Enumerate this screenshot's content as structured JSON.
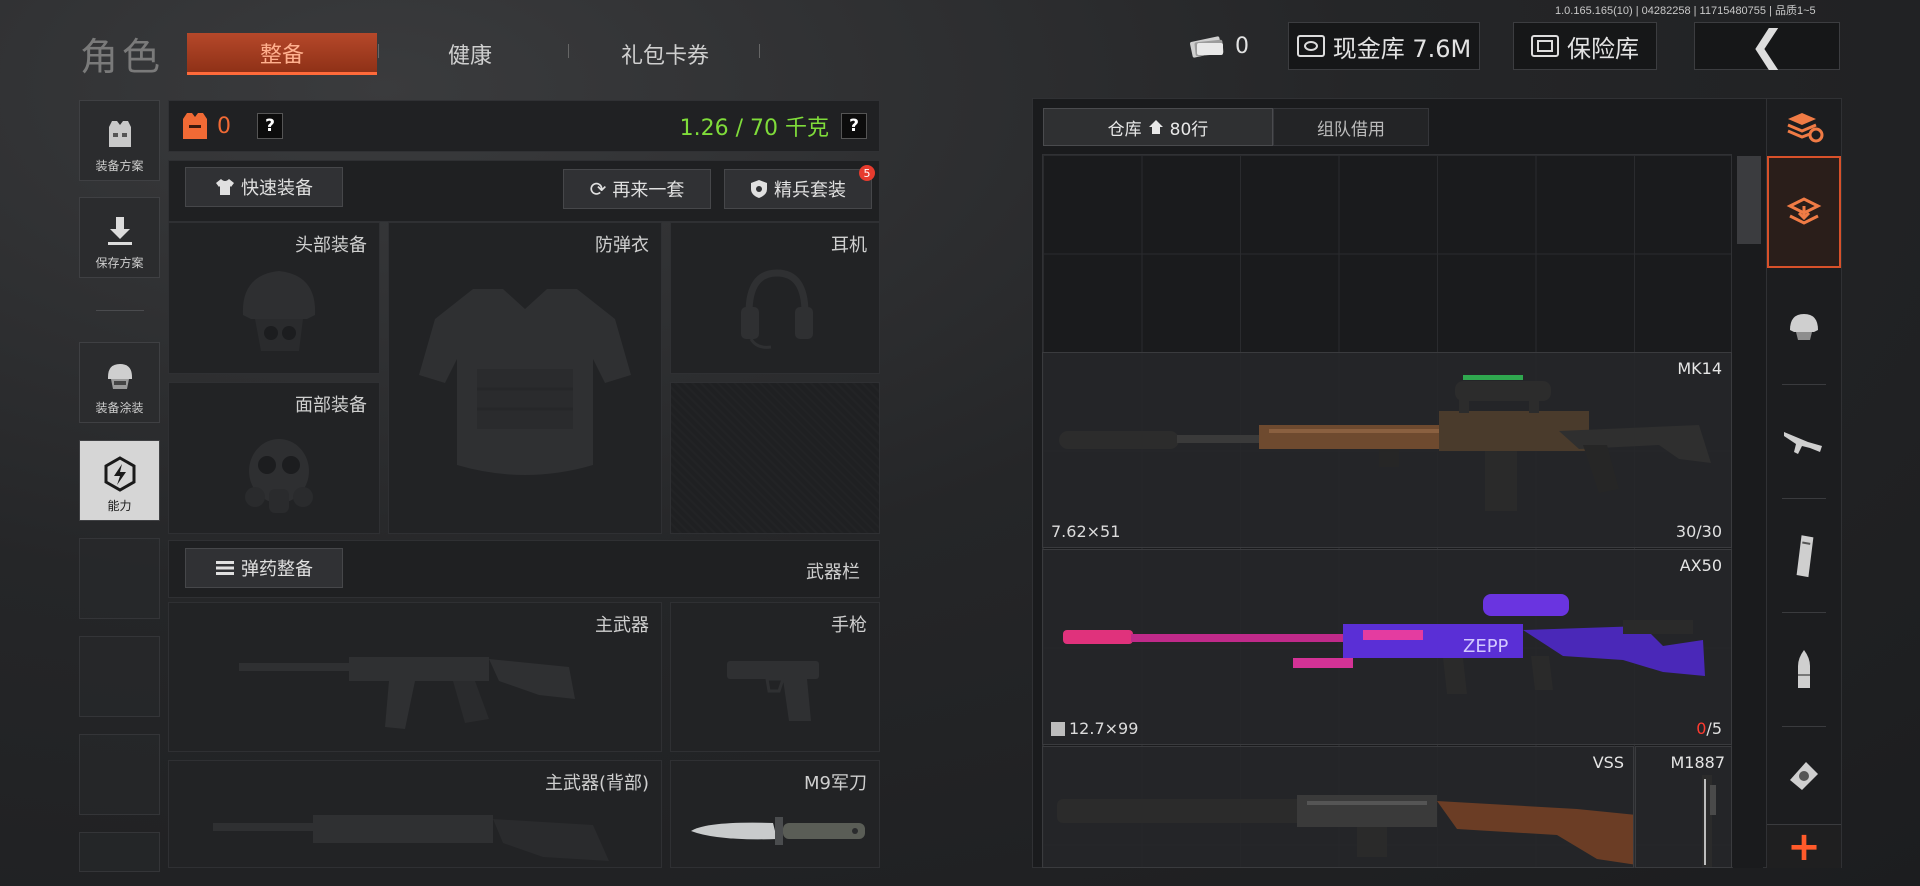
{
  "version": "1.0.165.165(10) | 04282258 | 11715480755 | 品质1~5",
  "header": {
    "title": "角色",
    "tabs": [
      {
        "label": "整备",
        "active": true
      },
      {
        "label": "健康",
        "active": false
      },
      {
        "label": "礼包卡券",
        "active": false
      }
    ],
    "ticket_count": "0",
    "cash_label": "现金库 7.6M",
    "safe_label": "保险库",
    "back_icon": "chevron-left-icon"
  },
  "sidebar": {
    "items": [
      {
        "label": "装备方案",
        "icon": "vest-plan-icon"
      },
      {
        "label": "保存方案",
        "icon": "download-icon"
      },
      {
        "label": "装备涂装",
        "icon": "helmet-skin-icon"
      },
      {
        "label": "能力",
        "icon": "ability-icon",
        "active": true
      }
    ]
  },
  "equip": {
    "armor_count": "0",
    "help": "?",
    "weight": "1.26 / 70 千克",
    "quick_equip": "快速装备",
    "another_set": "再来一套",
    "elite_set": "精兵套装",
    "elite_badge": "5",
    "slots": {
      "head": "头部装备",
      "vest": "防弹衣",
      "earphone": "耳机",
      "face": "面部装备"
    },
    "ammo_btn": "弹药整备",
    "weapon_bar": "武器栏",
    "weapons": {
      "primary": "主武器",
      "pistol": "手枪",
      "primary_back": "主武器(背部)",
      "knife": "M9军刀"
    }
  },
  "warehouse": {
    "tab_storage": "仓库",
    "rows": "80行",
    "tab_team": "组队借用",
    "items": [
      {
        "name": "MK14",
        "caliber": "7.62×51",
        "ammo_current": "30",
        "ammo_sep": "/",
        "ammo_max": "30"
      },
      {
        "name": "AX50",
        "caliber": "12.7×99",
        "ammo_current": "0",
        "ammo_sep": "/",
        "ammo_max": "5"
      },
      {
        "name": "VSS"
      },
      {
        "name": "M1887"
      }
    ]
  },
  "categories": [
    "all-icon",
    "stash-icon",
    "helmet-icon",
    "rifle-icon",
    "magazine-icon",
    "bullet-icon",
    "scope-icon",
    "add-icon"
  ],
  "colors": {
    "accent": "#d8512a",
    "weight_green": "#7fdc3a",
    "ammo_red": "#ff3b30"
  }
}
